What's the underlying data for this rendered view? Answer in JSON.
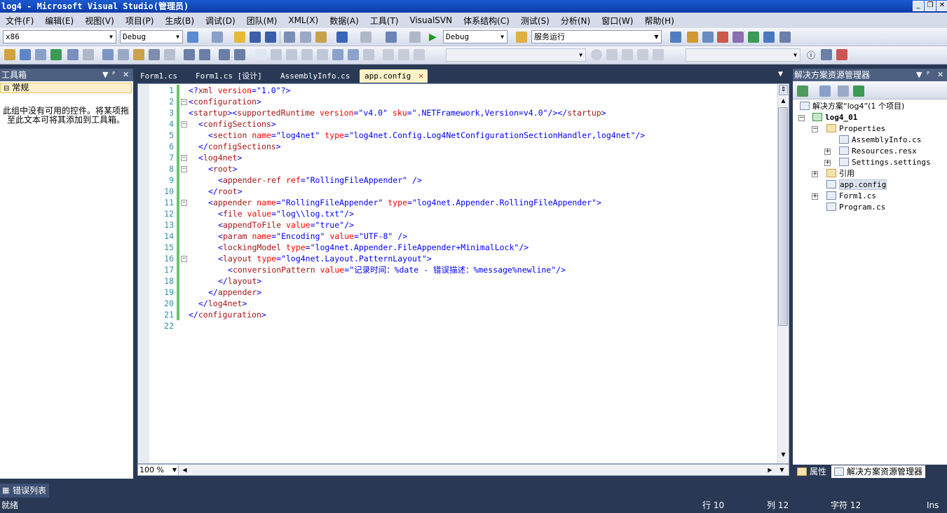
{
  "window": {
    "title": "log4 - Microsoft Visual Studio(管理员)",
    "buttons": [
      "_",
      "❐",
      "✕"
    ]
  },
  "menu": [
    "文件(F)",
    "编辑(E)",
    "视图(V)",
    "项目(P)",
    "生成(B)",
    "调试(D)",
    "团队(M)",
    "XML(X)",
    "数据(A)",
    "工具(T)",
    "VisualSVN",
    "体系结构(C)",
    "测试(S)",
    "分析(N)",
    "窗口(W)",
    "帮助(H)"
  ],
  "toolbar1": {
    "platform": "x86",
    "config": "Debug",
    "debug_config": "Debug",
    "find_value": "服务运行"
  },
  "toolbox": {
    "title": "工具箱",
    "category": "常规",
    "empty_message": "此组中没有可用的控件。将某项拖至此文本可将其添加到工具箱。"
  },
  "tabs": [
    {
      "label": "Form1.cs",
      "active": false
    },
    {
      "label": "Form1.cs [设计]",
      "active": false
    },
    {
      "label": "AssemblyInfo.cs",
      "active": false
    },
    {
      "label": "app.config",
      "active": true
    }
  ],
  "code_lines": [
    {
      "n": "1",
      "text": "<?xml version=\"1.0\"?>",
      "indent": 0,
      "fold": ""
    },
    {
      "n": "2",
      "text": "<configuration>",
      "indent": 0,
      "fold": "⊟"
    },
    {
      "n": "3",
      "text": "<startup><supportedRuntime version=\"v4.0\" sku=\".NETFramework,Version=v4.0\"/></startup>",
      "indent": 0,
      "fold": ""
    },
    {
      "n": "4",
      "text": "<configSections>",
      "indent": 1,
      "fold": "⊟"
    },
    {
      "n": "5",
      "text": "<section name=\"log4net\" type=\"log4net.Config.Log4NetConfigurationSectionHandler,log4net\"/>",
      "indent": 2,
      "fold": ""
    },
    {
      "n": "6",
      "text": "</configSections>",
      "indent": 1,
      "fold": ""
    },
    {
      "n": "7",
      "text": "<log4net>",
      "indent": 1,
      "fold": "⊟"
    },
    {
      "n": "8",
      "text": "<root>",
      "indent": 2,
      "fold": "⊟"
    },
    {
      "n": "9",
      "text": "<appender-ref ref=\"RollingFileAppender\" />",
      "indent": 3,
      "fold": ""
    },
    {
      "n": "10",
      "text": "</root>",
      "indent": 2,
      "fold": ""
    },
    {
      "n": "11",
      "text": "<appender name=\"RollingFileAppender\" type=\"log4net.Appender.RollingFileAppender\">",
      "indent": 2,
      "fold": "⊟"
    },
    {
      "n": "12",
      "text": "<file value=\"log\\\\log.txt\"/>",
      "indent": 3,
      "fold": ""
    },
    {
      "n": "13",
      "text": "<appendToFile value=\"true\"/>",
      "indent": 3,
      "fold": ""
    },
    {
      "n": "14",
      "text": "<param name=\"Encoding\" value=\"UTF-8\" />",
      "indent": 3,
      "fold": ""
    },
    {
      "n": "15",
      "text": "<lockingModel type=\"log4net.Appender.FileAppender+MinimalLock\"/>",
      "indent": 3,
      "fold": ""
    },
    {
      "n": "16",
      "text": "<layout type=\"log4net.Layout.PatternLayout\">",
      "indent": 3,
      "fold": "⊟"
    },
    {
      "n": "17",
      "text": "<conversionPattern value=\"记录时间：%date - 错误描述：%message%newline\"/>",
      "indent": 4,
      "fold": ""
    },
    {
      "n": "18",
      "text": "</layout>",
      "indent": 3,
      "fold": ""
    },
    {
      "n": "19",
      "text": "</appender>",
      "indent": 2,
      "fold": ""
    },
    {
      "n": "20",
      "text": "</log4net>",
      "indent": 1,
      "fold": ""
    },
    {
      "n": "21",
      "text": "</configuration>",
      "indent": 0,
      "fold": ""
    },
    {
      "n": "22",
      "text": "",
      "indent": 0,
      "fold": ""
    }
  ],
  "zoom": "100 %",
  "solution_explorer": {
    "title": "解决方案资源管理器",
    "items": [
      {
        "label": "解决方案“log4”(1 个项目)",
        "icon": "solution-icon",
        "level": 0,
        "expander": ""
      },
      {
        "label": "log4_01",
        "icon": "project-icon",
        "level": 0,
        "expander": "⊟",
        "bold": true
      },
      {
        "label": "Properties",
        "icon": "folder-icon",
        "level": 1,
        "expander": "⊟"
      },
      {
        "label": "AssemblyInfo.cs",
        "icon": "cs-file-icon",
        "level": 2,
        "expander": ""
      },
      {
        "label": "Resources.resx",
        "icon": "resx-file-icon",
        "level": 2,
        "expander": "⊞"
      },
      {
        "label": "Settings.settings",
        "icon": "settings-file-icon",
        "level": 2,
        "expander": "⊞"
      },
      {
        "label": "引用",
        "icon": "references-icon",
        "level": 1,
        "expander": "⊞"
      },
      {
        "label": "app.config",
        "icon": "config-file-icon",
        "level": 1,
        "expander": "",
        "selected": true
      },
      {
        "label": "Form1.cs",
        "icon": "form-file-icon",
        "level": 1,
        "expander": "⊞"
      },
      {
        "label": "Program.cs",
        "icon": "cs-file-icon",
        "level": 1,
        "expander": ""
      }
    ],
    "bottom_tabs": [
      "属性",
      "解决方案资源管理器"
    ]
  },
  "error_list_tab": "错误列表",
  "status": {
    "left": "就绪",
    "line": "行 10",
    "col": "列 12",
    "char": "字符 12",
    "mode": "Ins"
  }
}
